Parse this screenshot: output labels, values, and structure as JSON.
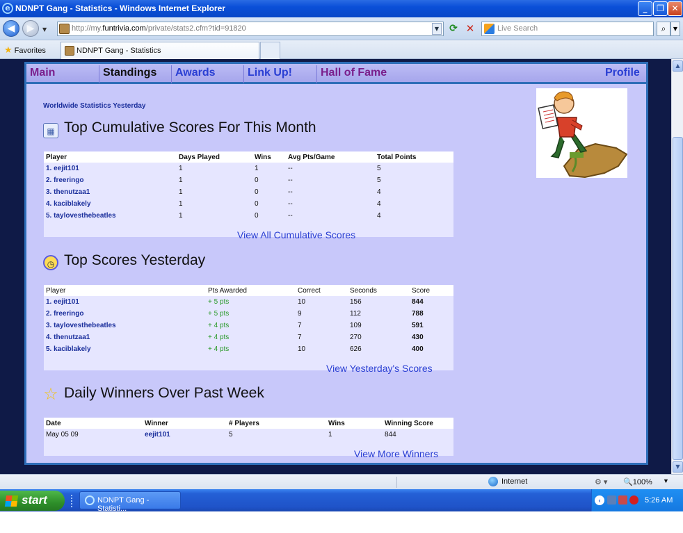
{
  "window": {
    "title": "NDNPT Gang - Statistics - Windows Internet Explorer",
    "controls": [
      "_",
      "❐",
      "✕"
    ]
  },
  "address_bar": {
    "url_prefix": "http://my.",
    "url_domain": "funtrivia.com",
    "url_path": "/private/stats2.cfm?tid=91820",
    "search_placeholder": "Live Search"
  },
  "favorites_bar": {
    "favorites_label": "Favorites",
    "tab_title": "NDNPT Gang - Statistics"
  },
  "site_nav": {
    "items": [
      {
        "label": "Main",
        "color": "#7a1f8c"
      },
      {
        "label": "Standings",
        "color": "#111111"
      },
      {
        "label": "Awards",
        "color": "#2a3fd3"
      },
      {
        "label": "Link Up!",
        "color": "#2a3fd3"
      },
      {
        "label": "Hall of Fame",
        "color": "#7a1f8c"
      },
      {
        "label": "Profile",
        "color": "#2a3fd3"
      }
    ]
  },
  "worldwide_link": "Worldwide Statistics Yesterday",
  "cumulative": {
    "heading": "Top Cumulative Scores For This Month",
    "headers": [
      "Player",
      "Days Played",
      "Wins",
      "Avg Pts/Game",
      "Total Points"
    ],
    "rows": [
      [
        "1.",
        "eejit101",
        "1",
        "1",
        "--",
        "5"
      ],
      [
        "2.",
        "freeringo",
        "1",
        "0",
        "--",
        "5"
      ],
      [
        "3.",
        "thenutzaa1",
        "1",
        "0",
        "--",
        "4"
      ],
      [
        "4.",
        "kaciblakely",
        "1",
        "0",
        "--",
        "4"
      ],
      [
        "5.",
        "taylovesthebeatles",
        "1",
        "0",
        "--",
        "4"
      ]
    ],
    "view_all": "View All Cumulative Scores"
  },
  "yesterday": {
    "heading": "Top Scores Yesterday",
    "headers": [
      "Player",
      "Pts Awarded",
      "Correct",
      "Seconds",
      "Score"
    ],
    "rows": [
      [
        "1.",
        "eejit101",
        "+ 5 pts",
        "10",
        "156",
        "844"
      ],
      [
        "2.",
        "freeringo",
        "+ 5 pts",
        "9",
        "112",
        "788"
      ],
      [
        "3.",
        "taylovesthebeatles",
        "+ 4 pts",
        "7",
        "109",
        "591"
      ],
      [
        "4.",
        "thenutzaa1",
        "+ 4 pts",
        "7",
        "270",
        "430"
      ],
      [
        "5.",
        "kaciblakely",
        "+ 4 pts",
        "10",
        "626",
        "400"
      ]
    ],
    "view_all": "View Yesterday's Scores"
  },
  "daily_winners": {
    "heading": "Daily Winners Over Past Week",
    "headers": [
      "Date",
      "Winner",
      "# Players",
      "Wins",
      "Winning Score"
    ],
    "rows": [
      [
        "May 05 09",
        "eejit101",
        "5",
        "1",
        "844"
      ]
    ],
    "view_all": "View More Winners"
  },
  "status_bar": {
    "zone": "Internet",
    "zoom": "100%"
  },
  "taskbar": {
    "start_label": "start",
    "task_item": "NDNPT Gang - Statisti...",
    "clock": "5:26 AM"
  }
}
